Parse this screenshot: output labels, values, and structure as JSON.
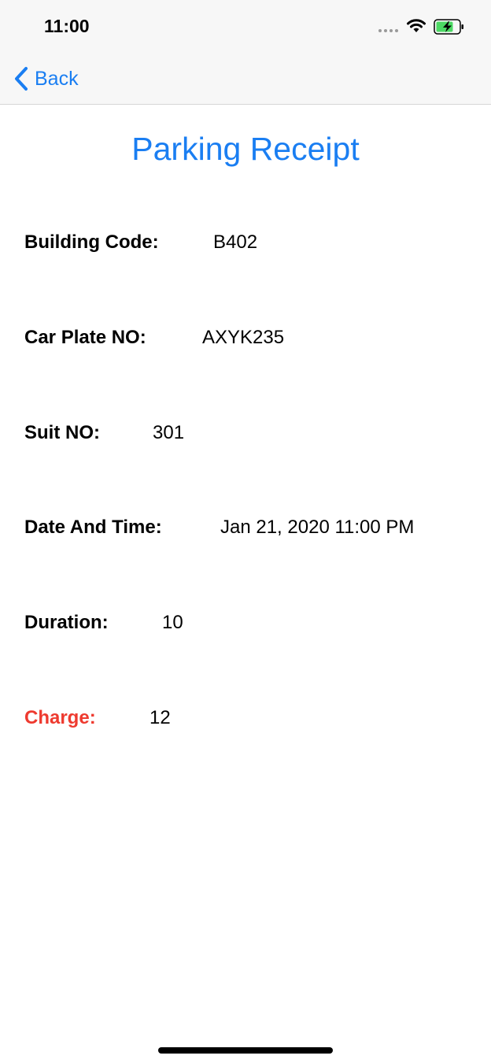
{
  "status_bar": {
    "time": "11:00",
    "icons": [
      "signal-dots-icon",
      "wifi-icon",
      "battery-charging-icon"
    ],
    "battery_color": "#4cd964"
  },
  "nav": {
    "back_label": "Back",
    "back_icon": "chevron-left-icon"
  },
  "title": "Parking Receipt",
  "receipt": {
    "building_code": {
      "label": "Building Code:",
      "value": "B402"
    },
    "car_plate": {
      "label": "Car Plate NO:",
      "value": "AXYK235"
    },
    "suit_no": {
      "label": "Suit NO:",
      "value": "301"
    },
    "date_time": {
      "label": "Date And Time:",
      "value": "Jan 21, 2020 11:00 PM"
    },
    "duration": {
      "label": "Duration:",
      "value": "10"
    },
    "charge": {
      "label": "Charge:",
      "value": "12"
    }
  },
  "colors": {
    "accent": "#1a7ef2",
    "charge_label": "#ee3a2f",
    "text": "#000000"
  }
}
